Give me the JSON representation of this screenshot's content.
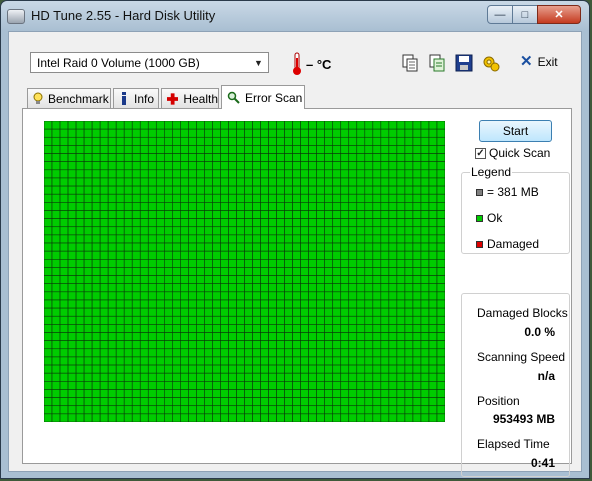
{
  "window": {
    "title": "HD Tune 2.55 - Hard Disk Utility",
    "controls": {
      "minimize": "—",
      "maximize": "□",
      "close": "✕"
    }
  },
  "toolbar": {
    "drive": "Intel   Raid 0 Volume (1000 GB)",
    "temperature": "– °C",
    "exit_label": "Exit",
    "icons": [
      "copy-icon",
      "copy-text-icon",
      "save-icon",
      "options-icon"
    ]
  },
  "tabs": [
    {
      "label": "Benchmark",
      "icon": "lightbulb-icon",
      "active": false
    },
    {
      "label": "Info",
      "icon": "info-icon",
      "active": false
    },
    {
      "label": "Health",
      "icon": "health-cross-icon",
      "active": false
    },
    {
      "label": "Error Scan",
      "icon": "magnifier-icon",
      "active": true
    }
  ],
  "scan": {
    "start_label": "Start",
    "quick_scan_label": "Quick Scan",
    "quick_scan_checked": true,
    "grid": {
      "columns": 50,
      "rows": 37,
      "ok_fraction": 1.0
    },
    "colors": {
      "ok": "#00cc00",
      "damaged": "#dd0000",
      "block": "#808080"
    }
  },
  "legend": {
    "title": "Legend",
    "items": [
      {
        "label": "= 381 MB",
        "color": "#808080"
      },
      {
        "label": "Ok",
        "color": "#00cc00"
      },
      {
        "label": "Damaged",
        "color": "#dd0000"
      }
    ]
  },
  "stats": [
    {
      "label": "Damaged Blocks",
      "value": "0.0 %"
    },
    {
      "label": "Scanning Speed",
      "value": "n/a"
    },
    {
      "label": "Position",
      "value": "953493 MB"
    },
    {
      "label": "Elapsed Time",
      "value": "0:41"
    }
  ]
}
